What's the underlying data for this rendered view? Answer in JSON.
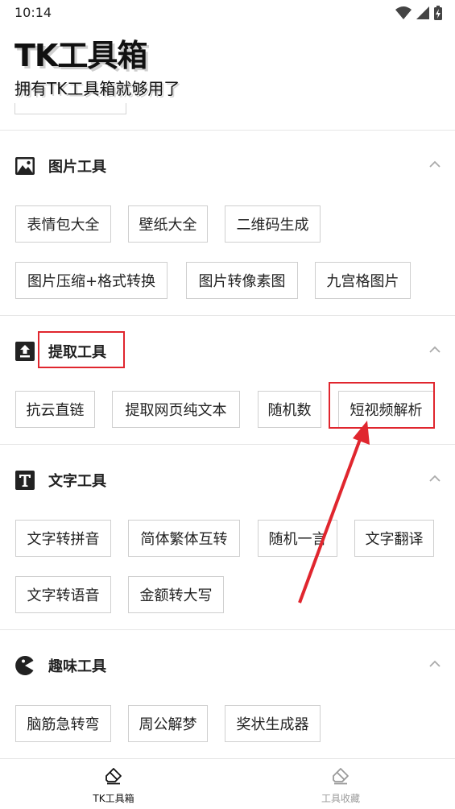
{
  "status": {
    "time": "10:14"
  },
  "header": {
    "title": "TK工具箱",
    "subtitle": "拥有TK工具箱就够用了"
  },
  "sections": [
    {
      "title": "图片工具",
      "icon": "image-icon",
      "tools": [
        "表情包大全",
        "壁纸大全",
        "二维码生成",
        "图片压缩+格式转换",
        "图片转像素图",
        "九宫格图片"
      ]
    },
    {
      "title": "提取工具",
      "icon": "upload-icon",
      "tools": [
        "抗云直链",
        "提取网页纯文本",
        "随机数",
        "短视频解析"
      ]
    },
    {
      "title": "文字工具",
      "icon": "text-t-icon",
      "tools": [
        "文字转拼音",
        "简体繁体互转",
        "随机一言",
        "文字翻译",
        "文字转语音",
        "金额转大写"
      ]
    },
    {
      "title": "趣味工具",
      "icon": "pacman-icon",
      "tools": [
        "脑筋急转弯",
        "周公解梦",
        "奖状生成器"
      ]
    }
  ],
  "bottom_nav": [
    {
      "label": "TK工具箱",
      "icon": "eraser-icon",
      "active": true
    },
    {
      "label": "工具收藏",
      "icon": "eraser-icon",
      "active": false
    }
  ],
  "colors": {
    "highlight": "#e0262e",
    "active_nav": "#111111",
    "inactive_nav": "#9a9a9a"
  }
}
